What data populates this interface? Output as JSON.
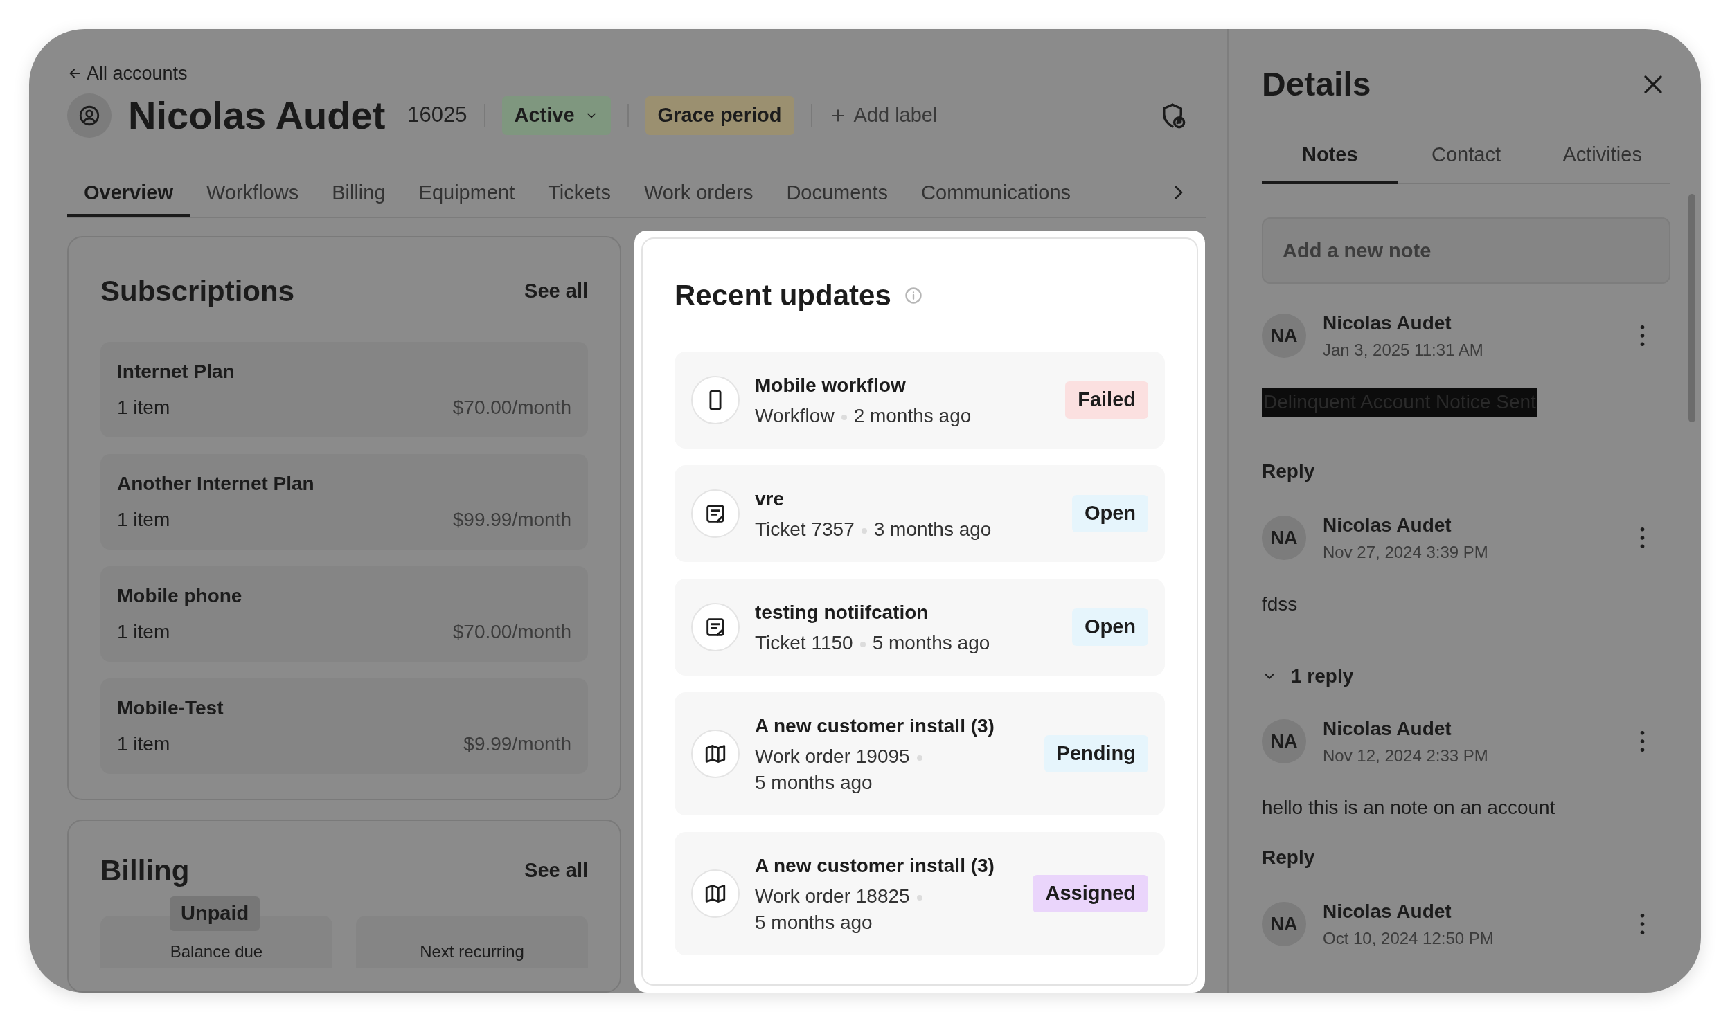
{
  "back_link": "All accounts",
  "account": {
    "name": "Nicolas Audet",
    "number": "16025",
    "status": "Active",
    "labels": [
      {
        "text": "Grace period",
        "color": "#9b9070"
      }
    ],
    "add_label": "Add label"
  },
  "tabs": [
    {
      "label": "Overview",
      "selected": true
    },
    {
      "label": "Workflows",
      "selected": false
    },
    {
      "label": "Billing",
      "selected": false
    },
    {
      "label": "Equipment",
      "selected": false
    },
    {
      "label": "Tickets",
      "selected": false
    },
    {
      "label": "Work orders",
      "selected": false
    },
    {
      "label": "Documents",
      "selected": false
    },
    {
      "label": "Communications",
      "selected": false
    }
  ],
  "subscriptions": {
    "title": "Subscriptions",
    "see_all": "See all",
    "items": [
      {
        "name": "Internet Plan",
        "count": "1 item",
        "price": "$70.00/month"
      },
      {
        "name": "Another Internet Plan",
        "count": "1 item",
        "price": "$99.99/month"
      },
      {
        "name": "Mobile phone",
        "count": "1 item",
        "price": "$70.00/month"
      },
      {
        "name": "Mobile-Test",
        "count": "1 item",
        "price": "$9.99/month"
      }
    ]
  },
  "billing": {
    "title": "Billing",
    "see_all": "See all",
    "badge": "Unpaid",
    "tiles": [
      "Balance due",
      "Next recurring"
    ]
  },
  "recent_updates": {
    "title": "Recent updates",
    "items": [
      {
        "kind": "phone",
        "title": "Mobile workflow",
        "type": "Workflow",
        "time": "2 months ago",
        "status": "Failed",
        "color": "#fbe0e0"
      },
      {
        "kind": "ticket",
        "title": "vre",
        "type": "Ticket 7357",
        "time": "3 months ago",
        "status": "Open",
        "color": "#e6f5fc"
      },
      {
        "kind": "ticket",
        "title": "testing notiifcation",
        "type": "Ticket 1150",
        "time": "5 months ago",
        "status": "Open",
        "color": "#e6f5fc"
      },
      {
        "kind": "map",
        "title": "A new customer install (3)",
        "type": "Work order 19095",
        "time": "5 months ago",
        "status": "Pending",
        "color": "#e6f5fc"
      },
      {
        "kind": "map",
        "title": "A new customer install (3)",
        "type": "Work order 18825",
        "time": "5 months ago",
        "status": "Assigned",
        "color": "#ead5fb"
      }
    ]
  },
  "details": {
    "title": "Details",
    "tabs": [
      {
        "label": "Notes",
        "selected": true
      },
      {
        "label": "Contact",
        "selected": false
      },
      {
        "label": "Activities",
        "selected": false
      }
    ],
    "note_placeholder": "Add a new note",
    "notes": [
      {
        "initials": "NA",
        "author": "Nicolas Audet",
        "date": "Jan 3, 2025 11:31 AM",
        "body": "Delinquent Account Notice Sent",
        "highlighted": true,
        "reply": "Reply"
      },
      {
        "initials": "NA",
        "author": "Nicolas Audet",
        "date": "Nov 27, 2024 3:39 PM",
        "body": "fdss",
        "highlighted": false,
        "replies_toggle": "1 reply",
        "expanded": true,
        "children": [
          {
            "initials": "NA",
            "author": "Nicolas Audet",
            "date": "Nov 12, 2024 2:33 PM",
            "body": "hello this is an note on an account",
            "highlighted": false,
            "reply": "Reply"
          }
        ]
      },
      {
        "initials": "NA",
        "author": "Nicolas Audet",
        "date": "Oct 10, 2024 12:50 PM"
      }
    ]
  }
}
